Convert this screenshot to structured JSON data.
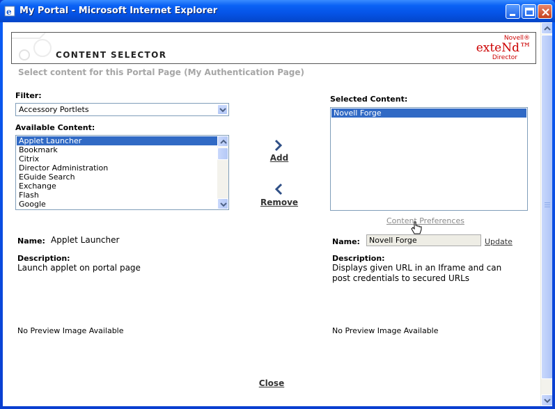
{
  "window": {
    "title": "My Portal - Microsoft Internet Explorer",
    "controls": [
      "minimize",
      "maximize",
      "close"
    ]
  },
  "banner": {
    "title": "CONTENT SELECTOR",
    "brand_top": "Novell®",
    "brand_main": "exteNd™",
    "brand_bottom": "Director"
  },
  "subtitle": "Select content for this Portal Page (My Authentication Page)",
  "filter": {
    "label": "Filter:",
    "selected": "Accessory Portlets"
  },
  "available": {
    "label": "Available Content:",
    "items": [
      "Applet Launcher",
      "Bookmark",
      "Citrix",
      "Director Administration",
      "EGuide Search",
      "Exchange",
      "Flash",
      "Google"
    ],
    "selected_index": 0
  },
  "actions": {
    "add": "Add",
    "remove": "Remove",
    "content_preferences": "Content Preferences",
    "update": "Update",
    "close": "Close"
  },
  "selected_content": {
    "label": "Selected Content:",
    "items": [
      "Novell Forge"
    ],
    "selected_index": 0
  },
  "left_detail": {
    "name_label": "Name:",
    "name": "Applet Launcher",
    "description_label": "Description:",
    "description": "Launch applet on portal page",
    "preview": "No Preview Image Available"
  },
  "right_detail": {
    "name_label": "Name:",
    "name_value": "Novell Forge",
    "description_label": "Description:",
    "description_line1": "Displays given URL in an Iframe and can",
    "description_line2": "post credentials to secured URLs",
    "preview": "No Preview Image Available"
  },
  "colors": {
    "titlebar": "#0553e6",
    "selection": "#316ac5",
    "brand": "#cc0000",
    "subtitle": "#a6a6a6"
  }
}
